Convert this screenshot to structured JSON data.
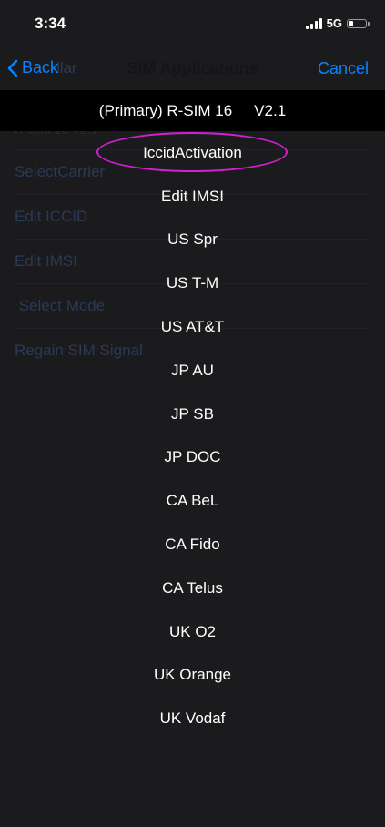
{
  "status_bar": {
    "time": "3:34",
    "network": "5G"
  },
  "nav": {
    "back_label": "Back",
    "back_ghost": "llar",
    "title": "SIM Applications",
    "cancel_label": "Cancel"
  },
  "background_list": {
    "sub_label": "R-SIM 16    V2.1",
    "items": [
      "SelectCarrier",
      "Edit ICCID",
      "Edit IMSI",
      " Select Mode",
      "Regain SIM Signal"
    ]
  },
  "picker": {
    "header_name": "(Primary) R-SIM 16",
    "header_version": "V2.1",
    "highlight_color": "#d020d0",
    "options": [
      "IccidActivation",
      "Edit IMSI",
      "US Spr",
      "US T-M",
      "US AT&T",
      "JP AU",
      "JP SB",
      "JP DOC",
      "CA BeL",
      "CA Fido",
      "CA Telus",
      "UK O2",
      "UK Orange",
      "UK Vodaf"
    ]
  }
}
